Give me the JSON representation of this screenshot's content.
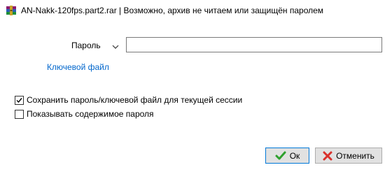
{
  "window": {
    "title": "AN-Nakk-120fps.part2.rar | Возможно, архив не читаем или защищён паролем",
    "icon": "winrar-archive-icon"
  },
  "form": {
    "password_label": "Пароль",
    "password_value": "",
    "keyfile_link": "Ключевой файл"
  },
  "options": {
    "save_password_label": "Сохранить пароль/ключевой файл для текущей сессии",
    "save_password_checked": true,
    "show_password_label": "Показывать содержимое пароля",
    "show_password_checked": false
  },
  "buttons": {
    "ok_label": "Ок",
    "cancel_label": "Отменить"
  },
  "colors": {
    "link": "#0066cc",
    "ok_check": "#2ea12e",
    "cancel_x": "#d9302b",
    "focus_border": "#0078d7"
  }
}
